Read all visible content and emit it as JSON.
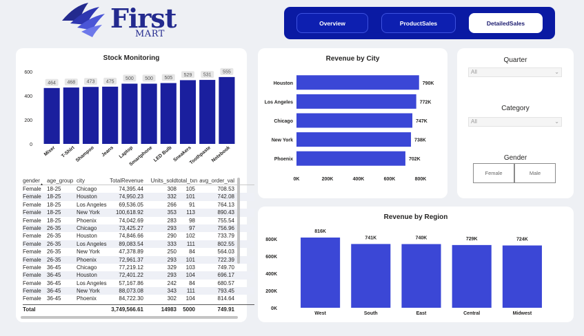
{
  "brand": {
    "name": "First",
    "sub": "MART"
  },
  "nav": {
    "overview": "Overview",
    "product_sales": "ProductSales",
    "detailed_sales": "DetailedSales"
  },
  "stock": {
    "title": "Stock Monitoring",
    "chart_data": {
      "type": "bar",
      "title": "Stock Monitoring",
      "categories": [
        "Mixer",
        "T-Shirt",
        "Shampoo",
        "Jeans",
        "Laptop",
        "Smartphone",
        "LED Bulb",
        "Sneakers",
        "Toothpaste",
        "Notebook"
      ],
      "values": [
        464,
        468,
        473,
        475,
        500,
        500,
        505,
        529,
        531,
        555
      ],
      "ylim": [
        0,
        600
      ],
      "yticks": [
        0,
        200,
        400,
        600
      ],
      "color": "#1a1f9e"
    }
  },
  "table": {
    "headers": [
      "gender",
      "age_group",
      "city",
      "TotalRevenue",
      "Units_sold",
      "total_txn",
      "avg_order_val"
    ],
    "rows": [
      [
        "Female",
        "18-25",
        "Chicago",
        "74,395.44",
        "308",
        "105",
        "708.53"
      ],
      [
        "Female",
        "18-25",
        "Houston",
        "74,950.23",
        "332",
        "101",
        "742.08"
      ],
      [
        "Female",
        "18-25",
        "Los Angeles",
        "69,536.05",
        "266",
        "91",
        "764.13"
      ],
      [
        "Female",
        "18-25",
        "New York",
        "100,618.92",
        "353",
        "113",
        "890.43"
      ],
      [
        "Female",
        "18-25",
        "Phoenix",
        "74,042.69",
        "283",
        "98",
        "755.54"
      ],
      [
        "Female",
        "26-35",
        "Chicago",
        "73,425.27",
        "293",
        "97",
        "756.96"
      ],
      [
        "Female",
        "26-35",
        "Houston",
        "74,846.66",
        "290",
        "102",
        "733.79"
      ],
      [
        "Female",
        "26-35",
        "Los Angeles",
        "89,083.54",
        "333",
        "111",
        "802.55"
      ],
      [
        "Female",
        "26-35",
        "New York",
        "47,378.89",
        "250",
        "84",
        "564.03"
      ],
      [
        "Female",
        "26-35",
        "Phoenix",
        "72,961.37",
        "293",
        "101",
        "722.39"
      ],
      [
        "Female",
        "36-45",
        "Chicago",
        "77,219.12",
        "329",
        "103",
        "749.70"
      ],
      [
        "Female",
        "36-45",
        "Houston",
        "72,401.22",
        "293",
        "104",
        "696.17"
      ],
      [
        "Female",
        "36-45",
        "Los Angeles",
        "57,167.86",
        "242",
        "84",
        "680.57"
      ],
      [
        "Female",
        "36-45",
        "New York",
        "88,073.08",
        "343",
        "111",
        "793.45"
      ],
      [
        "Female",
        "36-45",
        "Phoenix",
        "84,722.30",
        "302",
        "104",
        "814.64"
      ]
    ],
    "total": [
      "Total",
      "",
      "",
      "3,749,566.61",
      "14983",
      "5000",
      "749.91"
    ]
  },
  "city": {
    "title": "Revenue by City",
    "chart_data": {
      "type": "bar",
      "orientation": "horizontal",
      "title": "Revenue by City",
      "categories": [
        "Houston",
        "Los Angeles",
        "Chicago",
        "New York",
        "Phoenix"
      ],
      "values": [
        790000,
        772000,
        747000,
        738000,
        702000
      ],
      "labels": [
        "790K",
        "772K",
        "747K",
        "738K",
        "702K"
      ],
      "xlim": [
        0,
        800000
      ],
      "xticks": [
        "0K",
        "200K",
        "400K",
        "600K",
        "800K"
      ],
      "color": "#3b47d6"
    }
  },
  "region": {
    "title": "Revenue by Region",
    "chart_data": {
      "type": "bar",
      "title": "Revenue by Region",
      "categories": [
        "West",
        "South",
        "East",
        "Central",
        "Midwest"
      ],
      "values": [
        816000,
        741000,
        740000,
        729000,
        724000
      ],
      "labels": [
        "816K",
        "741K",
        "740K",
        "729K",
        "724K"
      ],
      "ylim": [
        0,
        800000
      ],
      "yticks": [
        "0K",
        "200K",
        "400K",
        "600K",
        "800K"
      ],
      "color": "#3b47d6"
    }
  },
  "filters": {
    "quarter": {
      "title": "Quarter",
      "value": "All"
    },
    "category": {
      "title": "Category",
      "value": "All"
    },
    "gender": {
      "title": "Gender",
      "options": [
        "Female",
        "Male"
      ]
    }
  }
}
